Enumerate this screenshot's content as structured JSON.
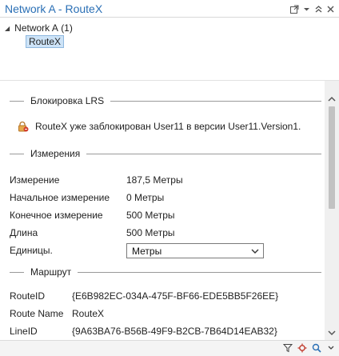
{
  "window": {
    "title": "Network A - RouteX"
  },
  "title_icons": [
    "popout-icon",
    "options-icon",
    "collapse-icon",
    "close-icon"
  ],
  "tree": {
    "root_label": "Network A",
    "root_count": "(1)",
    "child_label": "RouteX"
  },
  "lock": {
    "heading": "Блокировка LRS",
    "message": "RouteX уже заблокирован User11 в версии User11.Version1."
  },
  "measures": {
    "heading": "Измерения",
    "rows": [
      {
        "label": "Измерение",
        "value": "187,5 Метры"
      },
      {
        "label": "Начальное измерение",
        "value": "0 Метры"
      },
      {
        "label": "Конечное измерение",
        "value": "500 Метры"
      },
      {
        "label": "Длина",
        "value": "500 Метры"
      }
    ],
    "units_label": "Единицы.",
    "units_value": "Метры"
  },
  "route": {
    "heading": "Маршрут",
    "rows": [
      {
        "label": "RouteID",
        "value": "{E6B982EC-034A-475F-BF66-EDE5BB5F26EE}"
      },
      {
        "label": "Route Name",
        "value": "RouteX"
      },
      {
        "label": "LineID",
        "value": "{9A63BA76-B56B-49F9-B2CB-7B64D14EAB32}"
      }
    ]
  },
  "colors": {
    "title": "#2a6fb5",
    "selection": "#cde3f7",
    "lock_orange": "#d98a2a",
    "lock_red": "#d23b2a"
  },
  "status_icons": [
    "filter-icon",
    "settings-icon",
    "zoom-icon",
    "more-icon"
  ]
}
